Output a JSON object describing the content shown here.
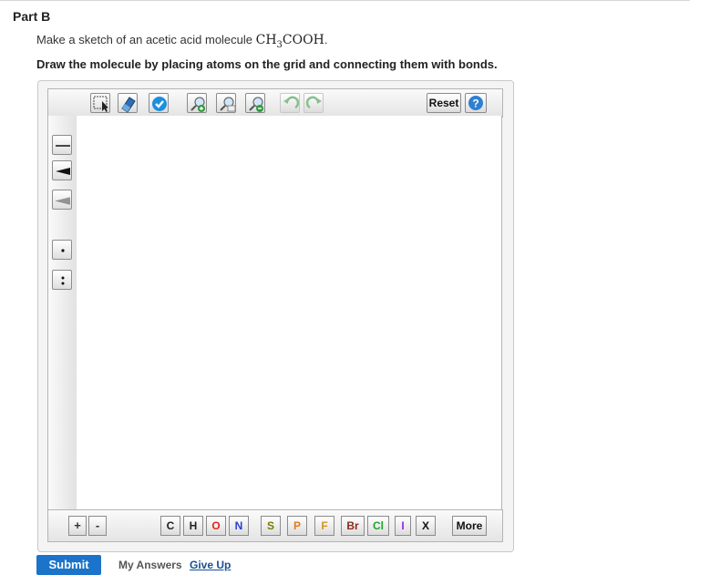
{
  "part": {
    "title": "Part B"
  },
  "question": {
    "prompt_before": "Make a sketch of an acetic acid molecule ",
    "formula_ch": "CH",
    "formula_sub": "3",
    "formula_rest": "COOH",
    "prompt_after": ".",
    "instruction": "Draw the molecule by placing atoms on the grid and connecting them with bonds."
  },
  "toolbar": {
    "reset_label": "Reset",
    "help_label": "?",
    "tools": [
      "select-tool",
      "eraser-tool",
      "check-tool",
      "zoom-in-tool",
      "zoom-fit-tool",
      "zoom-out-tool",
      "undo-tool",
      "redo-tool"
    ]
  },
  "left_tools": [
    "single-bond",
    "wedge-bond",
    "hash-bond",
    "radical",
    "lone-pair"
  ],
  "bottom": {
    "charge_plus": "+",
    "charge_minus": "-",
    "atoms": [
      {
        "symbol": "C",
        "color": "#222222"
      },
      {
        "symbol": "H",
        "color": "#222222"
      },
      {
        "symbol": "O",
        "color": "#e3231b"
      },
      {
        "symbol": "N",
        "color": "#2b3dd6"
      },
      {
        "symbol": "S",
        "color": "#7a7a00"
      },
      {
        "symbol": "P",
        "color": "#e07b1c"
      },
      {
        "symbol": "F",
        "color": "#d4951c"
      },
      {
        "symbol": "Br",
        "color": "#8b2a1a"
      },
      {
        "symbol": "Cl",
        "color": "#1ea52a"
      },
      {
        "symbol": "I",
        "color": "#8a2be2"
      },
      {
        "symbol": "X",
        "color": "#111111"
      }
    ],
    "more_label": "More"
  },
  "actions": {
    "submit": "Submit",
    "my_answers": "My Answers",
    "give_up": "Give Up"
  }
}
